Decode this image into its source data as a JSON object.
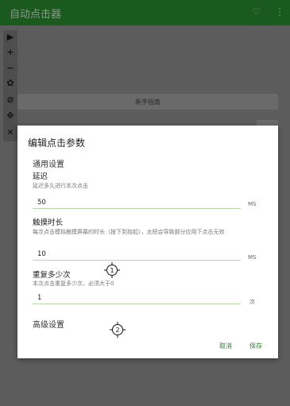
{
  "app": {
    "title": "自动点击器"
  },
  "toolbar": {
    "icons": [
      "play-icon",
      "plus-icon",
      "minus-icon",
      "gear-icon",
      "hide-icon",
      "move-icon",
      "close-icon"
    ]
  },
  "background": {
    "guide_label": "新手指南"
  },
  "dialog": {
    "title": "编辑点击参数",
    "general_section": "通用设置",
    "delay": {
      "label": "延迟",
      "desc": "延迟多久进行本次点击",
      "value": "50",
      "unit": "MS"
    },
    "touch_duration": {
      "label": "触摸时长",
      "desc": "每次点击模拟触摸屏幕的时长（按下到抬起），太短会导致部分应用下点击无效",
      "value": "10",
      "unit": "MS"
    },
    "repeat": {
      "label": "重复多少次",
      "desc": "本次点击重复多少次，必须大于0",
      "value": "1",
      "unit": "次"
    },
    "advanced_section": "高级设置",
    "cancel_label": "取消",
    "save_label": "保存"
  },
  "targets": [
    {
      "number": "1"
    },
    {
      "number": "2"
    }
  ],
  "colors": {
    "appbar": "#1b5a1e",
    "accent": "#2e7d32",
    "underline": "#b7d7a6"
  }
}
